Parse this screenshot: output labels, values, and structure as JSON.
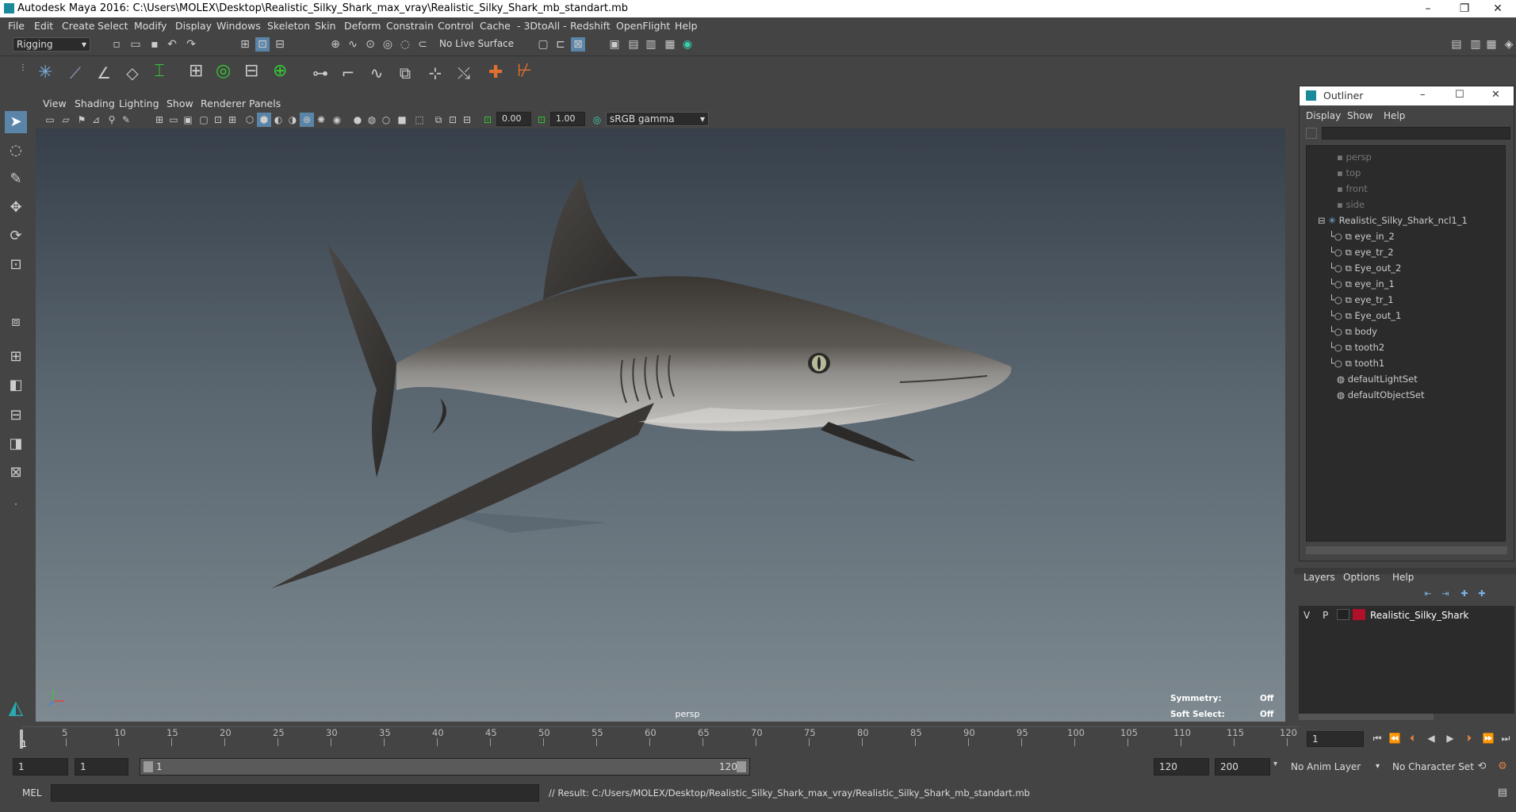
{
  "window": {
    "title": "Autodesk Maya 2016: C:\\Users\\MOLEX\\Desktop\\Realistic_Silky_Shark_max_vray\\Realistic_Silky_Shark_mb_standart.mb",
    "minimize": "–",
    "maximize": "❐",
    "close": "✕"
  },
  "menubar": [
    "File",
    "Edit",
    "Create",
    "Select",
    "Modify",
    "Display",
    "Windows",
    "Skeleton",
    "Skin",
    "Deform",
    "Constrain",
    "Control",
    "Cache",
    "- 3DtoAll -",
    "Redshift",
    "OpenFlight",
    "Help"
  ],
  "statusline": {
    "mode": "Rigging",
    "live_surface": "No Live Surface"
  },
  "panel_menu": [
    "View",
    "Shading",
    "Lighting",
    "Show",
    "Renderer",
    "Panels"
  ],
  "viewtools": {
    "exposure": "0.00",
    "gamma": "1.00",
    "colorspace": "sRGB gamma"
  },
  "viewport": {
    "camera": "persp",
    "symmetry_label": "Symmetry:",
    "symmetry_value": "Off",
    "soft_select_label": "Soft Select:",
    "soft_select_value": "Off"
  },
  "outliner": {
    "title": "Outliner",
    "menu": [
      "Display",
      "Show",
      "Help"
    ],
    "items": [
      {
        "label": "persp",
        "dim": true,
        "indent": 1
      },
      {
        "label": "top",
        "dim": true,
        "indent": 1
      },
      {
        "label": "front",
        "dim": true,
        "indent": 1
      },
      {
        "label": "side",
        "dim": true,
        "indent": 1
      },
      {
        "label": "Realistic_Silky_Shark_ncl1_1",
        "dim": false,
        "indent": 1
      },
      {
        "label": "eye_in_2",
        "dim": false,
        "indent": 2
      },
      {
        "label": "eye_tr_2",
        "dim": false,
        "indent": 2
      },
      {
        "label": "Eye_out_2",
        "dim": false,
        "indent": 2
      },
      {
        "label": "eye_in_1",
        "dim": false,
        "indent": 2
      },
      {
        "label": "eye_tr_1",
        "dim": false,
        "indent": 2
      },
      {
        "label": "Eye_out_1",
        "dim": false,
        "indent": 2
      },
      {
        "label": "body",
        "dim": false,
        "indent": 2
      },
      {
        "label": "tooth2",
        "dim": false,
        "indent": 2
      },
      {
        "label": "tooth1",
        "dim": false,
        "indent": 2
      },
      {
        "label": "defaultLightSet",
        "dim": false,
        "indent": 1
      },
      {
        "label": "defaultObjectSet",
        "dim": false,
        "indent": 1
      }
    ]
  },
  "layers": {
    "menu": [
      "Layers",
      "Options",
      "Help"
    ],
    "layer": {
      "v": "V",
      "p": "P",
      "name": "Realistic_Silky_Shark",
      "color": "#b0102a"
    }
  },
  "timeline": {
    "ticks": [
      "5",
      "10",
      "15",
      "20",
      "25",
      "30",
      "35",
      "40",
      "45",
      "50",
      "55",
      "60",
      "65",
      "70",
      "75",
      "80",
      "85",
      "90",
      "95",
      "100",
      "105",
      "110",
      "115",
      "120"
    ],
    "current_start_marker": "1",
    "current_frame": "1"
  },
  "range": {
    "start": "1",
    "playback_start": "1",
    "slider_start": "1",
    "slider_end": "120",
    "playback_end": "120",
    "end": "200",
    "anim_layer": "No Anim Layer",
    "character_set": "No Character Set"
  },
  "cmdline": {
    "lang": "MEL",
    "result": "// Result: C:/Users/MOLEX/Desktop/Realistic_Silky_Shark_max_vray/Realistic_Silky_Shark_mb_standart.mb"
  }
}
